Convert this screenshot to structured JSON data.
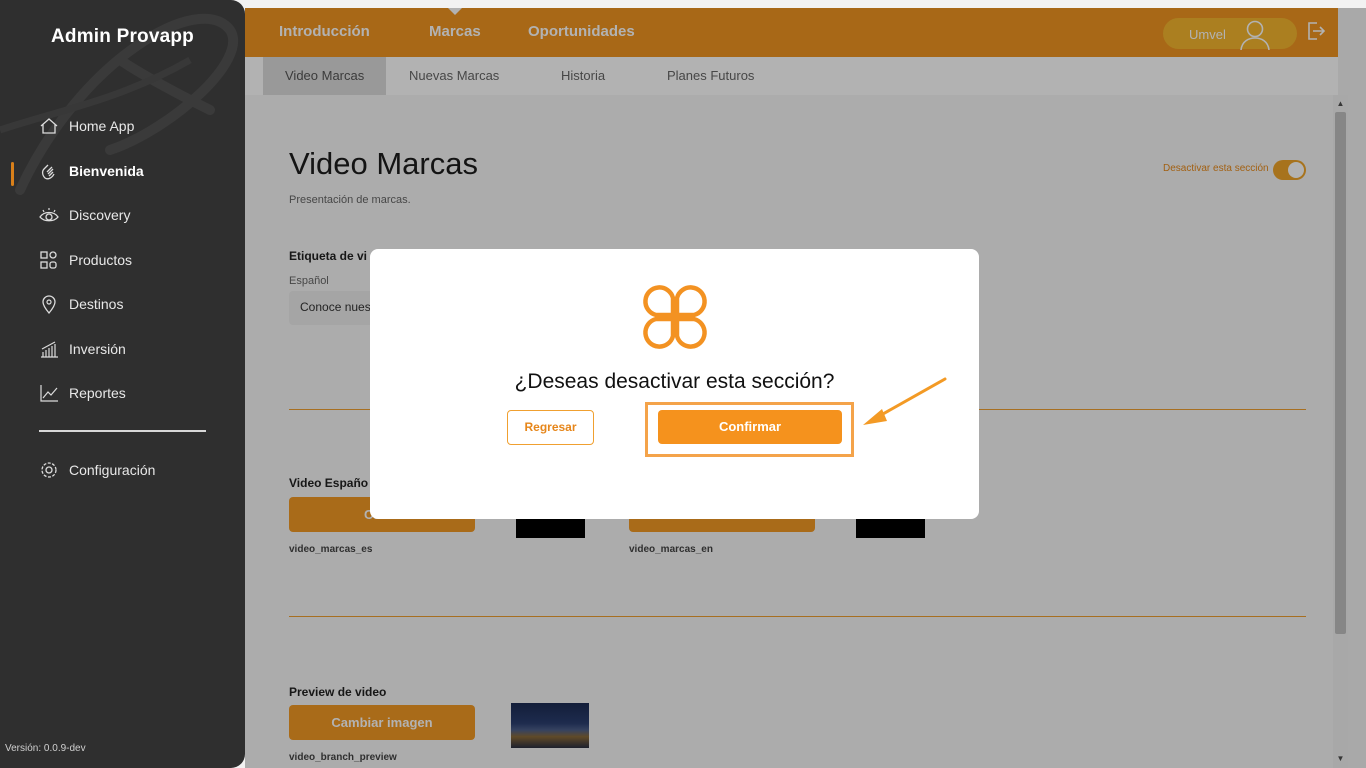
{
  "sidebar": {
    "title": "Admin Provapp",
    "items": [
      {
        "label": "Home App",
        "icon": "home-icon"
      },
      {
        "label": "Bienvenida",
        "icon": "wave-hand-icon",
        "active": true
      },
      {
        "label": "Discovery",
        "icon": "eye-icon"
      },
      {
        "label": "Productos",
        "icon": "grid-shapes-icon"
      },
      {
        "label": "Destinos",
        "icon": "location-pin-icon"
      },
      {
        "label": "Inversión",
        "icon": "bar-growth-icon"
      },
      {
        "label": "Reportes",
        "icon": "line-chart-icon"
      }
    ],
    "settings_label": "Configuración",
    "version": "Versión: 0.0.9-dev"
  },
  "topnav": {
    "tabs": [
      "Introducción",
      "Marcas",
      "Oportunidades"
    ],
    "active_tab": "Marcas",
    "user_name": "Umvel"
  },
  "subnav": {
    "tabs": [
      "Video Marcas",
      "Nuevas Marcas",
      "Historia",
      "Planes Futuros"
    ],
    "active_tab": "Video Marcas"
  },
  "page": {
    "title": "Video Marcas",
    "subtitle": "Presentación de marcas.",
    "toggle_label": "Desactivar esta sección",
    "toggle_on": true,
    "label_field_heading": "Etiqueta de vi",
    "label_lang": "Español",
    "label_value": "Conoce nues",
    "video_es_heading": "Video Españo",
    "video_es_button": "Camb",
    "video_es_file": "video_marcas_es",
    "video_en_file": "video_marcas_en",
    "preview_heading": "Preview de video",
    "preview_button": "Cambiar imagen",
    "preview_file": "video_branch_preview"
  },
  "modal": {
    "question": "¿Deseas desactivar esta sección?",
    "back_label": "Regresar",
    "confirm_label": "Confirmar",
    "logo_icon": "clover-logo-icon"
  },
  "colors": {
    "accent": "#f19622",
    "sidebar_bg": "#2f2f2f",
    "highlight": "#f4a34a"
  }
}
